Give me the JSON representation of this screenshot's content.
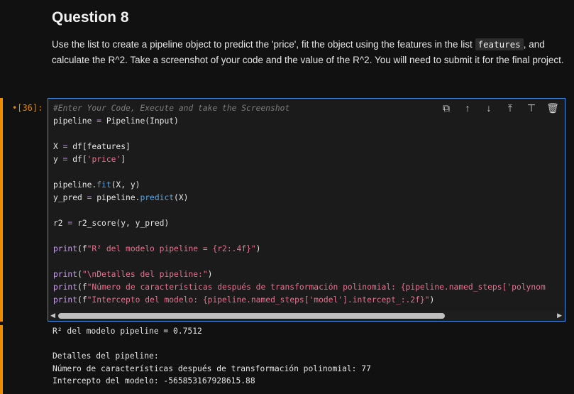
{
  "markdown": {
    "title": "Question 8",
    "text_before": "Use the list to create a pipeline object to predict the 'price', fit the object using the features in the list ",
    "inline_code": "features",
    "text_after": ", and calculate the R^2. Take a screenshot of your code and the value of the R^2. You will need to submit it for the final project."
  },
  "cell": {
    "prompt": "[36]:",
    "toolbar": [
      "copy-icon",
      "arrow-up-icon",
      "arrow-down-icon",
      "insert-above-icon",
      "insert-below-icon",
      "trash-icon"
    ],
    "code_lines": [
      "#Enter Your Code, Execute and take the Screenshot",
      "pipeline = Pipeline(Input)",
      "",
      "X = df[features]",
      "y = df['price']",
      "",
      "pipeline.fit(X, y)",
      "y_pred = pipeline.predict(X)",
      "",
      "r2 = r2_score(y, y_pred)",
      "",
      "print(f\"R² del modelo pipeline = {r2:.4f}\")",
      "",
      "print(\"\\nDetalles del pipeline:\")",
      "print(f\"Número de características después de transformación polinomial: {pipeline.named_steps['polynom",
      "print(f\"Intercepto del modelo: {pipeline.named_steps['model'].intercept_:.2f}\")"
    ]
  },
  "output": {
    "lines": [
      "R² del modelo pipeline = 0.7512",
      "",
      "Detalles del pipeline:",
      "Número de características después de transformación polinomial: 77",
      "Intercepto del modelo: -565853167928615.88"
    ]
  },
  "colors": {
    "accent_blue": "#3a8ee6",
    "prompt_orange": "#e08a00",
    "background": "#111111"
  }
}
